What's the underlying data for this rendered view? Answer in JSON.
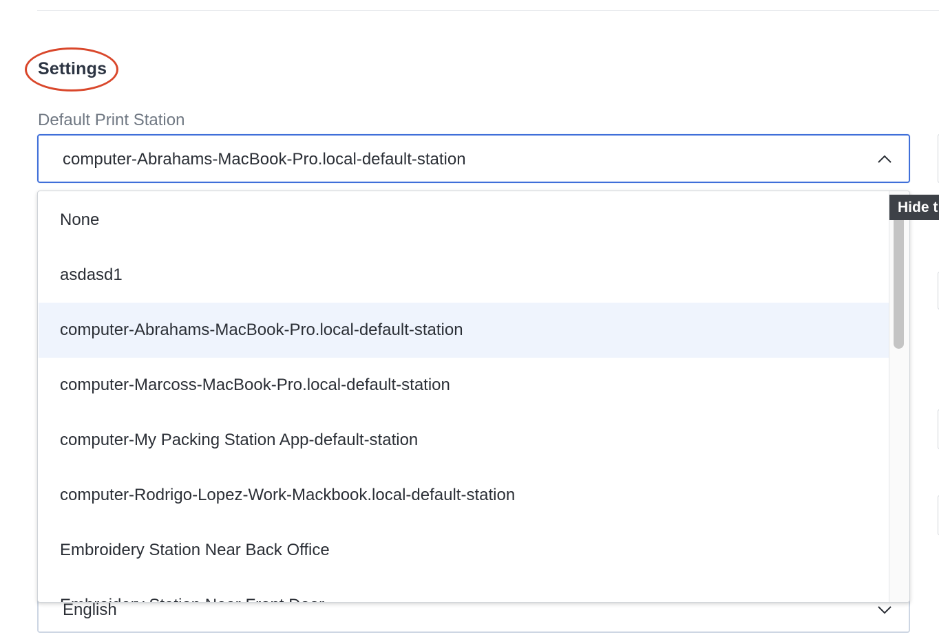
{
  "settings": {
    "title": "Settings"
  },
  "print_station": {
    "label": "Default Print Station",
    "value": "computer-Abrahams-MacBook-Pro.local-default-station",
    "options": [
      "None",
      "asdasd1",
      "computer-Abrahams-MacBook-Pro.local-default-station",
      "computer-Marcoss-MacBook-Pro.local-default-station",
      "computer-My Packing Station App-default-station",
      "computer-Rodrigo-Lopez-Work-Mackbook.local-default-station",
      "Embroidery Station Near Back Office",
      "Embroidery Station Near Front Door"
    ],
    "selected_index": 2
  },
  "language": {
    "value": "English"
  },
  "tooltip": {
    "text": "Hide t"
  },
  "colors": {
    "focus_border": "#3f6fd9",
    "highlight_circle": "#d9472b",
    "selected_option_bg": "#eff4fd",
    "tooltip_bg": "#3d4147"
  },
  "icons": {
    "dropdown_open": "chevron-up-icon",
    "dropdown_closed": "chevron-down-icon"
  }
}
